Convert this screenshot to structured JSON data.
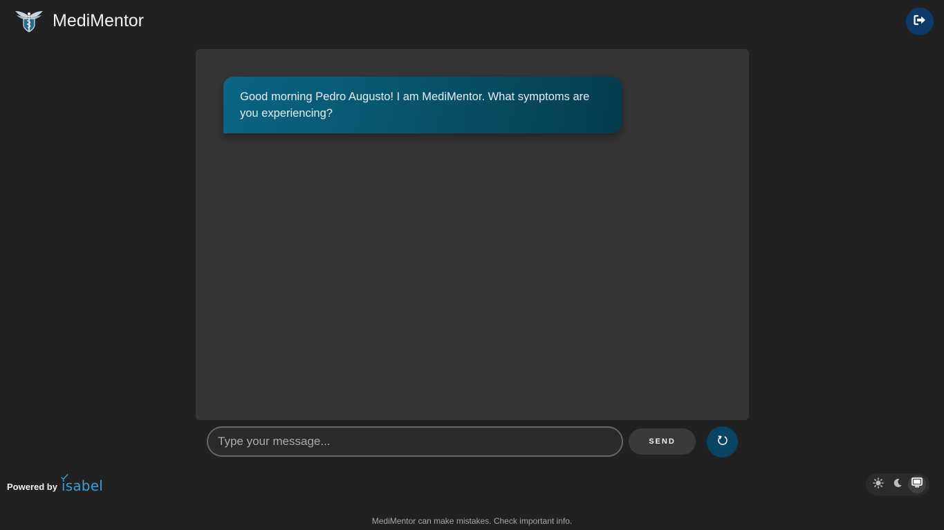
{
  "header": {
    "brand": "MediMentor",
    "logo_icon": "caduceus-wings-logo",
    "logout_icon": "sign-out-icon"
  },
  "chat": {
    "messages": [
      {
        "role": "assistant",
        "text": "Good morning Pedro Augusto! I am MediMentor. What symptoms are you experiencing?"
      }
    ]
  },
  "composer": {
    "placeholder": "Type your message...",
    "value": "",
    "send_label": "SEND",
    "reset_icon": "refresh-icon"
  },
  "footer": {
    "powered_label": "Powered by",
    "powered_brand": "isabel",
    "disclaimer": "MediMentor can make mistakes. Check important info.",
    "theme_options": [
      "light-theme-sun-icon",
      "dark-theme-moon-icon",
      "system-theme-monitor-icon"
    ],
    "theme_selected": "system"
  },
  "colors": {
    "background": "#212121",
    "panel": "#353535",
    "bubble_accent": "#0b6584",
    "logout_button": "#0d3a66",
    "reset_button": "#0b4362",
    "isabel_brand": "#3aa0d8"
  }
}
